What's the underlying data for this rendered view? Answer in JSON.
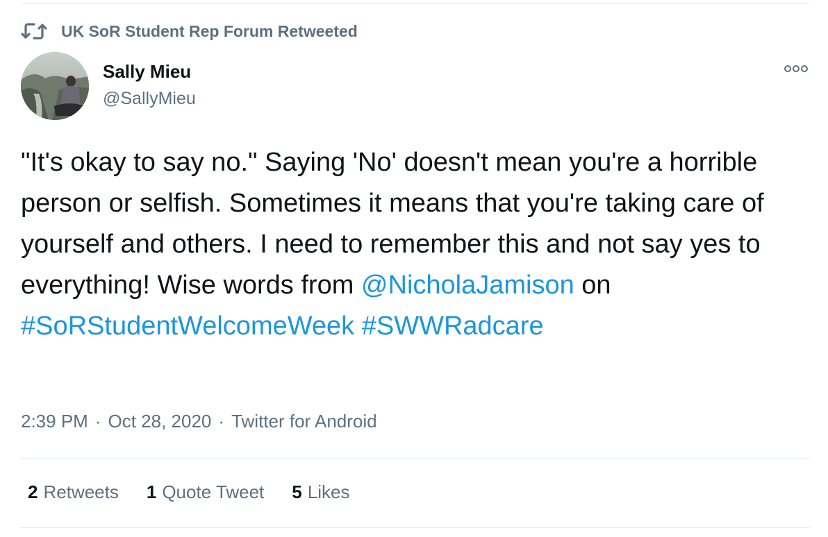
{
  "retweet_context": {
    "icon": "retweet-icon",
    "text": "UK SoR Student Rep Forum Retweeted"
  },
  "author": {
    "display_name": "Sally Mieu",
    "handle": "@SallyMieu",
    "avatar": "avatar-photo"
  },
  "more_button": {
    "icon": "more-dots-icon"
  },
  "tweet": {
    "text_part1": "\"It's okay to say no.\" Saying 'No' doesn't mean you're a horrible person or selfish. Sometimes it means that you're taking care of yourself and others. I need to remember this and not say yes to everything! Wise words from ",
    "mention": "@NicholaJamison",
    "text_part2": " on ",
    "hashtag1": "#SoRStudentWelcomeWeek",
    "text_part3": " ",
    "hashtag2": "#SWWRadcare"
  },
  "meta": {
    "time": "2:39 PM",
    "separator1": "·",
    "date": "Oct 28, 2020",
    "separator2": "·",
    "client": "Twitter for Android"
  },
  "stats": {
    "retweets": {
      "count": "2",
      "label": "Retweets"
    },
    "quote_tweets": {
      "count": "1",
      "label": "Quote Tweet"
    },
    "likes": {
      "count": "5",
      "label": "Likes"
    }
  },
  "colors": {
    "link": "#1b95e0",
    "secondary_text": "#5b7083",
    "primary_text": "#0f1419",
    "divider": "#e6ecf0"
  }
}
